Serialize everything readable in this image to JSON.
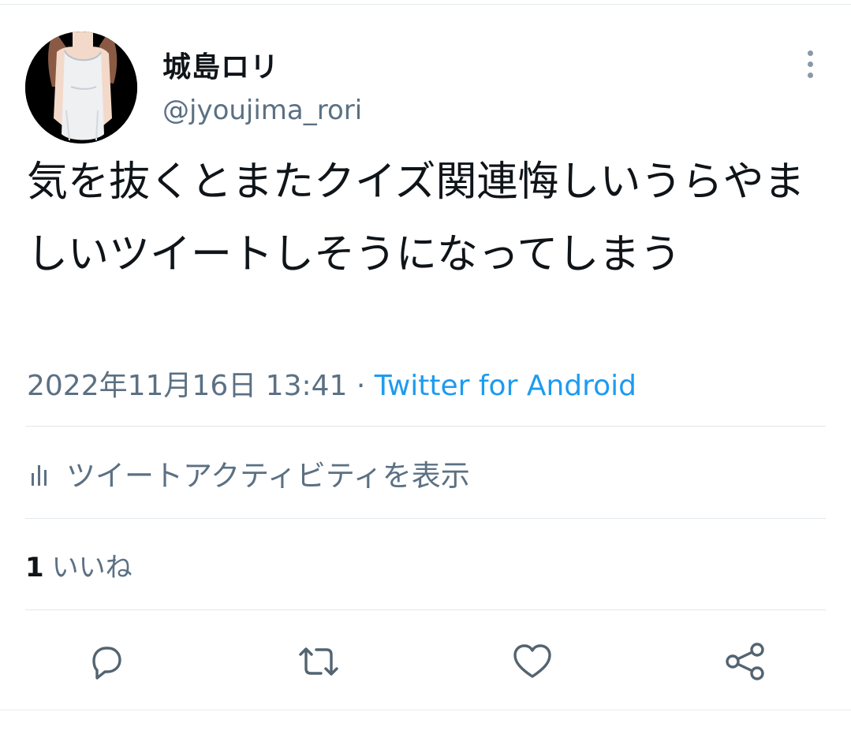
{
  "user": {
    "display_name": "城島ロリ",
    "handle": "@jyoujima_rori"
  },
  "tweet": {
    "text": "気を抜くとまたクイズ関連悔しいうらやましいツイートしそうになってしまう",
    "timestamp": "2022年11月16日 13:41",
    "separator": " · ",
    "source": "Twitter for Android"
  },
  "activity": {
    "label": "ツイートアクティビティを表示"
  },
  "stats": {
    "likes_count": "1",
    "likes_label": "いいね"
  },
  "icons": {
    "more": "more-vertical-icon",
    "activity": "bar-chart-icon",
    "reply": "reply-icon",
    "retweet": "retweet-icon",
    "like": "heart-icon",
    "share": "share-icon"
  },
  "colors": {
    "link": "#1d9bf0",
    "secondary_text": "#5b7083",
    "icon": "#536471",
    "divider": "#e1e8ed"
  }
}
